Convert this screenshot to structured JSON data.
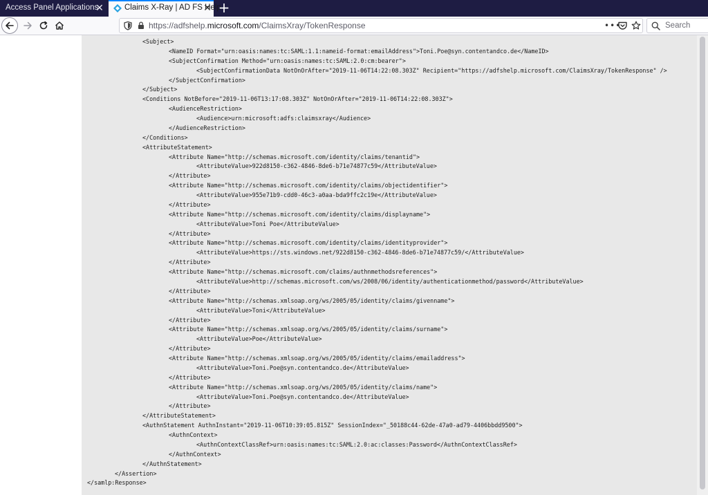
{
  "tabs": [
    {
      "title": "Access Panel Applications",
      "active": false
    },
    {
      "title": "Claims X-Ray | AD FS Help",
      "active": true
    }
  ],
  "new_tab_label": "+",
  "close_glyph": "✕",
  "url": {
    "prefix": "https://adfshelp.",
    "domain": "microsoft.com",
    "path": "/ClaimsXray/TokenResponse"
  },
  "page_actions_label": "•••",
  "search": {
    "placeholder": "Search"
  },
  "colors": {
    "tabbar": "#1e1c43",
    "accent": "#0a84ff",
    "content_bg": "#e8e8e8"
  },
  "icons": [
    "back-arrow-icon",
    "forward-arrow-icon",
    "reload-icon",
    "home-icon",
    "shield-icon",
    "lock-icon",
    "pocket-icon",
    "star-icon",
    "search-icon",
    "claims-xray-favicon"
  ],
  "xml": {
    "lines": [
      {
        "i": 2,
        "t": "<Subject>"
      },
      {
        "i": 3,
        "t": "<NameID Format=\"urn:oasis:names:tc:SAML:1.1:nameid-format:emailAddress\">Toni.Poe@syn.contentandco.de</NameID>"
      },
      {
        "i": 3,
        "t": "<SubjectConfirmation Method=\"urn:oasis:names:tc:SAML:2.0:cm:bearer\">"
      },
      {
        "i": 4,
        "t": "<SubjectConfirmationData NotOnOrAfter=\"2019-11-06T14:22:08.303Z\" Recipient=\"https://adfshelp.microsoft.com/ClaimsXray/TokenResponse\" />"
      },
      {
        "i": 3,
        "t": "</SubjectConfirmation>"
      },
      {
        "i": 2,
        "t": "</Subject>"
      },
      {
        "i": 2,
        "t": "<Conditions NotBefore=\"2019-11-06T13:17:08.303Z\" NotOnOrAfter=\"2019-11-06T14:22:08.303Z\">"
      },
      {
        "i": 3,
        "t": "<AudienceRestriction>"
      },
      {
        "i": 4,
        "t": "<Audience>urn:microsoft:adfs:claimsxray</Audience>"
      },
      {
        "i": 3,
        "t": "</AudienceRestriction>"
      },
      {
        "i": 2,
        "t": "</Conditions>"
      },
      {
        "i": 2,
        "t": "<AttributeStatement>"
      },
      {
        "i": 3,
        "t": "<Attribute Name=\"http://schemas.microsoft.com/identity/claims/tenantid\">"
      },
      {
        "i": 4,
        "t": "<AttributeValue>922d8150-c362-4846-8de6-b71e74877c59</AttributeValue>"
      },
      {
        "i": 3,
        "t": "</Attribute>"
      },
      {
        "i": 3,
        "t": "<Attribute Name=\"http://schemas.microsoft.com/identity/claims/objectidentifier\">"
      },
      {
        "i": 4,
        "t": "<AttributeValue>955e71b9-cdd0-46c3-a0aa-bda9ffc2c19e</AttributeValue>"
      },
      {
        "i": 3,
        "t": "</Attribute>"
      },
      {
        "i": 3,
        "t": "<Attribute Name=\"http://schemas.microsoft.com/identity/claims/displayname\">"
      },
      {
        "i": 4,
        "t": "<AttributeValue>Toni Poe</AttributeValue>"
      },
      {
        "i": 3,
        "t": "</Attribute>"
      },
      {
        "i": 3,
        "t": "<Attribute Name=\"http://schemas.microsoft.com/identity/claims/identityprovider\">"
      },
      {
        "i": 4,
        "t": "<AttributeValue>https://sts.windows.net/922d8150-c362-4846-8de6-b71e74877c59/</AttributeValue>"
      },
      {
        "i": 3,
        "t": "</Attribute>"
      },
      {
        "i": 3,
        "t": "<Attribute Name=\"http://schemas.microsoft.com/claims/authnmethodsreferences\">"
      },
      {
        "i": 4,
        "t": "<AttributeValue>http://schemas.microsoft.com/ws/2008/06/identity/authenticationmethod/password</AttributeValue>"
      },
      {
        "i": 3,
        "t": "</Attribute>"
      },
      {
        "i": 3,
        "t": "<Attribute Name=\"http://schemas.xmlsoap.org/ws/2005/05/identity/claims/givenname\">"
      },
      {
        "i": 4,
        "t": "<AttributeValue>Toni</AttributeValue>"
      },
      {
        "i": 3,
        "t": "</Attribute>"
      },
      {
        "i": 3,
        "t": "<Attribute Name=\"http://schemas.xmlsoap.org/ws/2005/05/identity/claims/surname\">"
      },
      {
        "i": 4,
        "t": "<AttributeValue>Poe</AttributeValue>"
      },
      {
        "i": 3,
        "t": "</Attribute>"
      },
      {
        "i": 3,
        "t": "<Attribute Name=\"http://schemas.xmlsoap.org/ws/2005/05/identity/claims/emailaddress\">"
      },
      {
        "i": 4,
        "t": "<AttributeValue>Toni.Poe@syn.contentandco.de</AttributeValue>"
      },
      {
        "i": 3,
        "t": "</Attribute>"
      },
      {
        "i": 3,
        "t": "<Attribute Name=\"http://schemas.xmlsoap.org/ws/2005/05/identity/claims/name\">"
      },
      {
        "i": 4,
        "t": "<AttributeValue>Toni.Poe@syn.contentandco.de</AttributeValue>"
      },
      {
        "i": 3,
        "t": "</Attribute>"
      },
      {
        "i": 2,
        "t": "</AttributeStatement>"
      },
      {
        "i": 2,
        "t": "<AuthnStatement AuthnInstant=\"2019-11-06T10:39:05.815Z\" SessionIndex=\"_50188c44-62de-47a0-ad79-4406bbdd9500\">"
      },
      {
        "i": 3,
        "t": "<AuthnContext>"
      },
      {
        "i": 4,
        "t": "<AuthnContextClassRef>urn:oasis:names:tc:SAML:2.0:ac:classes:Password</AuthnContextClassRef>"
      },
      {
        "i": 3,
        "t": "</AuthnContext>"
      },
      {
        "i": 2,
        "t": "</AuthnStatement>"
      },
      {
        "i": 1,
        "t": "</Assertion>"
      },
      {
        "i": 0,
        "t": "</samlp:Response>"
      }
    ]
  }
}
